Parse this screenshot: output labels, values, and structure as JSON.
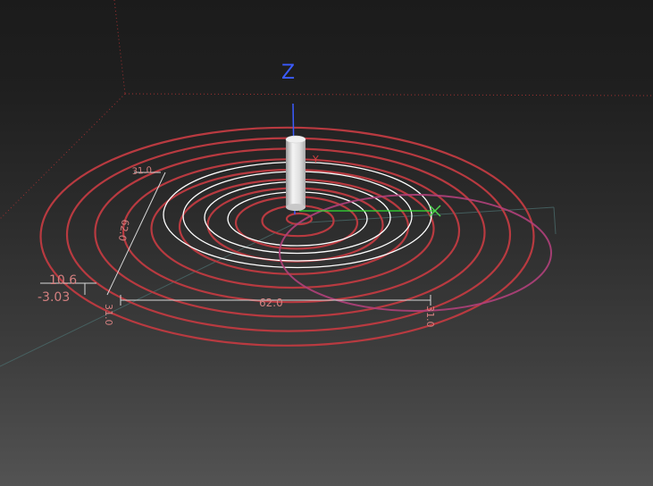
{
  "viewport": {
    "axis": {
      "z_label": "Z"
    },
    "dimensions": {
      "diameter_label": "62.0",
      "height_label": "31.0",
      "depth_label": "62.0",
      "offset_label_1": "10.6",
      "offset_label_2": "-3.03",
      "left_tick_label": "31.0",
      "right_tick_label": "31.0"
    }
  },
  "colors": {
    "spiral": "#b83a40",
    "tool_path": "#ffffff",
    "arc": "#c0407a",
    "axis_z": "#3b5bff",
    "axis_x": "#34e034",
    "marker": "#4cd44c",
    "dims": "#d48080"
  }
}
